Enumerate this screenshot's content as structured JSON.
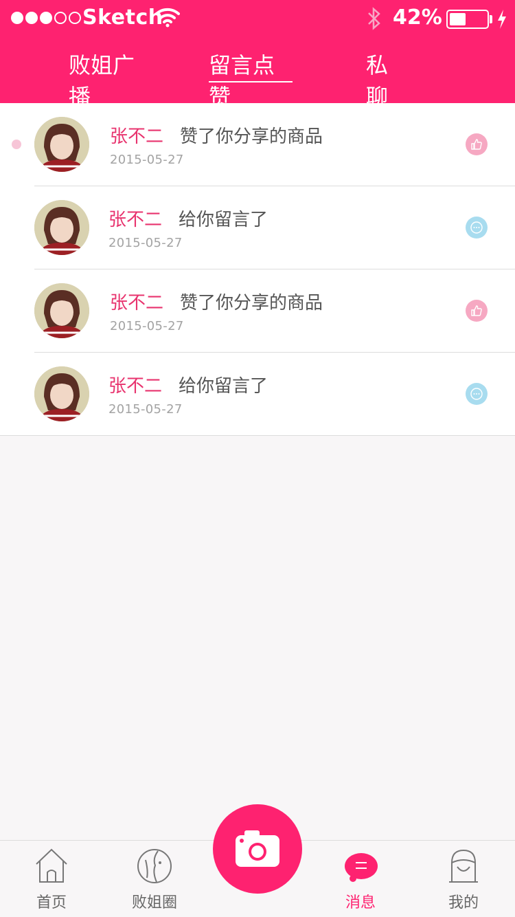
{
  "status_bar": {
    "carrier": "Sketch",
    "battery_percent": "42%",
    "battery_level": 0.42
  },
  "tabs": [
    {
      "label": "败姐广播",
      "active": false
    },
    {
      "label": "留言点赞",
      "active": true
    },
    {
      "label": "私聊",
      "active": false
    }
  ],
  "notifications": [
    {
      "user": "张不二",
      "action": "赞了你分享的商品",
      "date": "2015-05-27",
      "type": "like",
      "unread": true
    },
    {
      "user": "张不二",
      "action": "给你留言了",
      "date": "2015-05-27",
      "type": "comment",
      "unread": false
    },
    {
      "user": "张不二",
      "action": "赞了你分享的商品",
      "date": "2015-05-27",
      "type": "like",
      "unread": false
    },
    {
      "user": "张不二",
      "action": "给你留言了",
      "date": "2015-05-27",
      "type": "comment",
      "unread": false
    }
  ],
  "bottom_nav": [
    {
      "label": "首页",
      "icon": "home-icon",
      "active": false
    },
    {
      "label": "败姐圈",
      "icon": "circle-face-icon",
      "active": false
    },
    {
      "label": "消息",
      "icon": "message-bubble-icon",
      "active": true
    },
    {
      "label": "我的",
      "icon": "profile-icon",
      "active": false
    }
  ],
  "center_button": {
    "icon": "camera-icon"
  },
  "colors": {
    "brand": "#fe2270",
    "name_text": "#e8336e",
    "like_icon_bg": "#f6a8c2",
    "comment_icon_bg": "#a8dcef",
    "unread_dot": "#f7c5d7",
    "background": "#f8f6f7"
  }
}
